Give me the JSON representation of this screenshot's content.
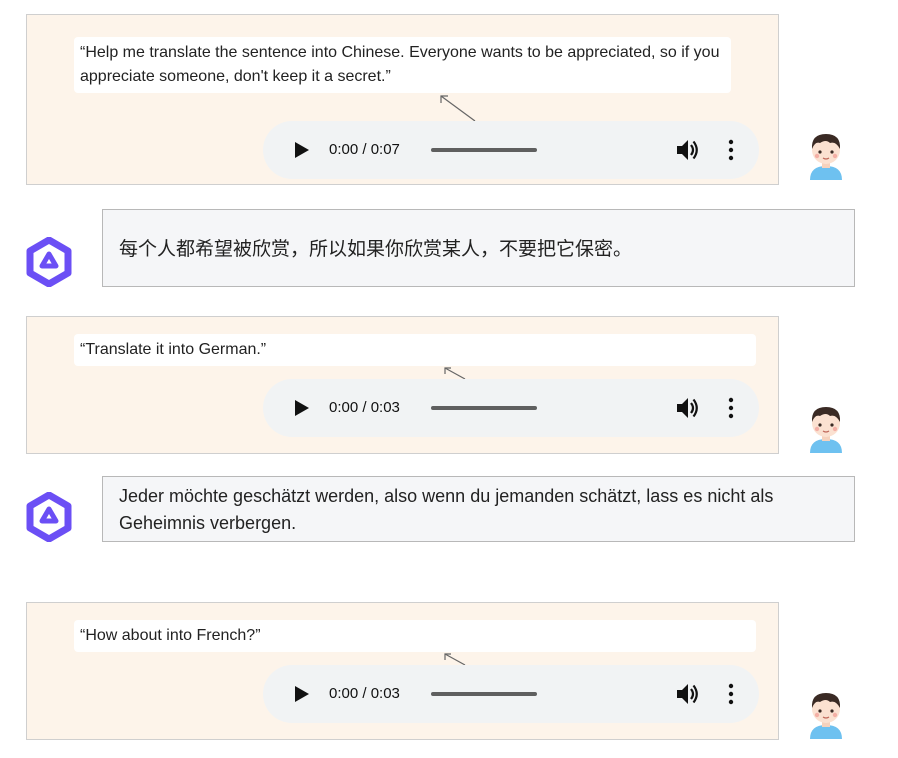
{
  "turns": [
    {
      "role": "user",
      "transcript": "“Help me translate the sentence into Chinese. Everyone wants to be appreciated, so if you appreciate someone, don't keep it a secret.”",
      "audio": {
        "current_time": "0:00",
        "duration": "0:07",
        "time_display": "0:00 / 0:07"
      }
    },
    {
      "role": "assistant",
      "text": "每个人都希望被欣赏，所以如果你欣赏某人，不要把它保密。"
    },
    {
      "role": "user",
      "transcript": "“Translate it into German.”",
      "audio": {
        "current_time": "0:00",
        "duration": "0:03",
        "time_display": "0:00 / 0:03"
      }
    },
    {
      "role": "assistant",
      "text": "Jeder möchte geschätzt werden, also wenn du jemanden schätzt, lass es nicht als Geheimnis verbergen."
    },
    {
      "role": "user",
      "transcript": "“How about into French?”",
      "audio": {
        "current_time": "0:00",
        "duration": "0:03",
        "time_display": "0:00 / 0:03"
      }
    }
  ],
  "colors": {
    "user_bubble_bg": "#fdf4ea",
    "assistant_bubble_bg": "#f5f6f8",
    "player_bg": "#f1f3f4",
    "logo_purple": "#6b4ff5"
  },
  "icons": {
    "user_avatar": "boy-avatar-icon",
    "assistant_avatar": "qwen-logo-icon",
    "play": "play-icon",
    "volume": "volume-icon",
    "more": "more-vertical-icon"
  }
}
